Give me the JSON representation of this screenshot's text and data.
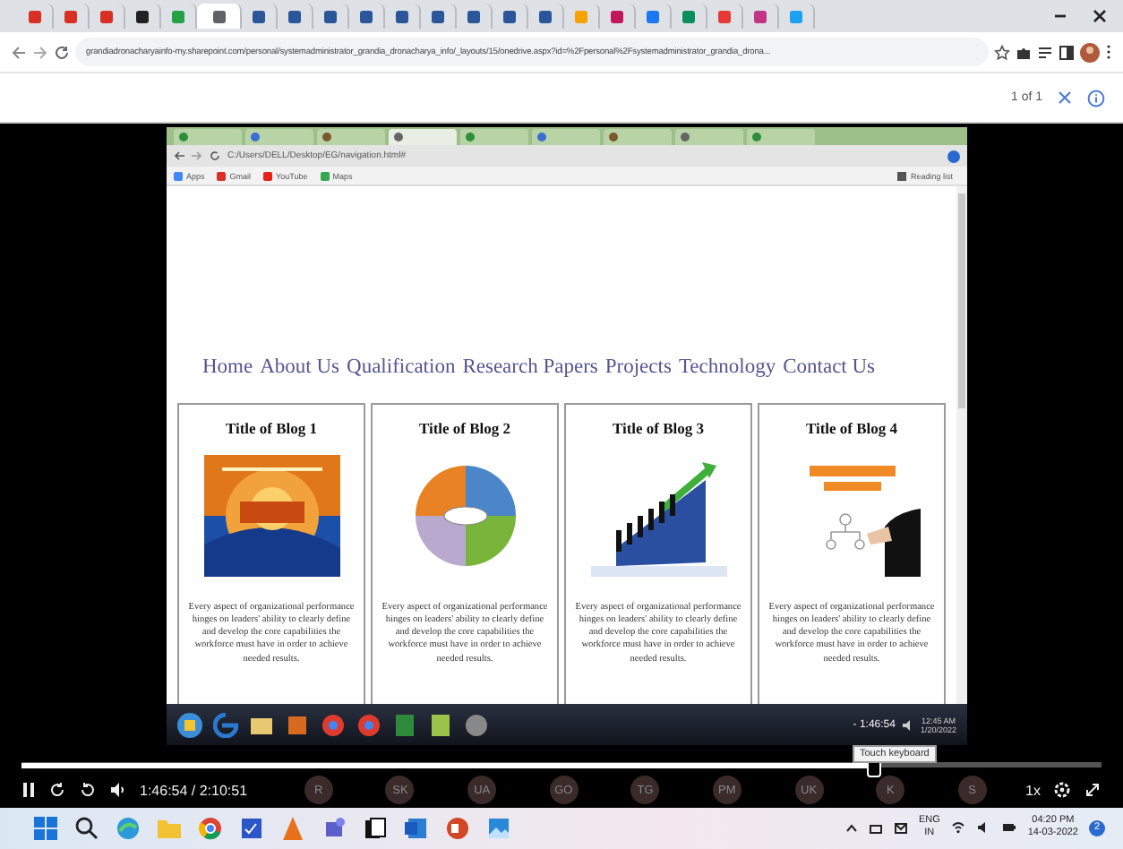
{
  "browser": {
    "tabs": [
      {
        "selected": false
      },
      {
        "selected": false
      },
      {
        "selected": false
      },
      {
        "selected": false
      },
      {
        "selected": false
      },
      {
        "selected": true
      },
      {
        "selected": false
      },
      {
        "selected": false
      },
      {
        "selected": false
      },
      {
        "selected": false
      },
      {
        "selected": false
      },
      {
        "selected": false
      },
      {
        "selected": false
      },
      {
        "selected": false
      },
      {
        "selected": false
      },
      {
        "selected": false
      },
      {
        "selected": false
      },
      {
        "selected": false
      },
      {
        "selected": false
      },
      {
        "selected": false
      },
      {
        "selected": false
      },
      {
        "selected": false
      }
    ],
    "address": "grandiadronacharyainfo-my.sharepoint.com/personal/systemadministrator_grandia_dronacharya_info/_layouts/15/onedrive.aspx?id=%2Fpersonal%2Fsystemadministrator_grandia_drona...",
    "page_count": "1 of 1"
  },
  "video": {
    "inner_browser": {
      "tabs": [
        {
          "selected": false
        },
        {
          "selected": false
        },
        {
          "selected": false
        },
        {
          "selected": true
        },
        {
          "selected": false
        },
        {
          "selected": false
        },
        {
          "selected": false
        },
        {
          "selected": false
        },
        {
          "selected": false
        }
      ],
      "address": "C:/Users/DELL/Desktop/EG/navigation.html#",
      "bookmarks": [
        "Apps",
        "Gmail",
        "YouTube",
        "Maps"
      ],
      "reading_list": "Reading list"
    },
    "nav": [
      "Home",
      "About Us",
      "Qualification",
      "Research Papers",
      "Projects",
      "Technology",
      "Contact Us"
    ],
    "blogs": [
      {
        "title": "Title of Blog 1",
        "text": "Every aspect of organizational performance hinges on leaders' ability to clearly define and develop the core capabilities the workforce must have in order to achieve needed results."
      },
      {
        "title": "Title of Blog 2",
        "text": "Every aspect of organizational performance hinges on leaders' ability to clearly define and develop the core capabilities the workforce must have in order to achieve needed results."
      },
      {
        "title": "Title of Blog 3",
        "text": "Every aspect of organizational performance hinges on leaders' ability to clearly define and develop the core capabilities the workforce must have in order to achieve needed results."
      },
      {
        "title": "Title of Blog 4",
        "text": "Every aspect of organizational performance hinges on leaders' ability to clearly define and develop the core capabilities the workforce must have in order to achieve needed results."
      }
    ],
    "taskbar": {
      "timer": "- 1:46:54",
      "time": "12:45 AM",
      "date": "1/20/2022"
    }
  },
  "player": {
    "level": 0.79,
    "time": "1:46:54 / 2:10:51",
    "participants": [
      "R",
      "SK",
      "UA",
      "GO",
      "TG",
      "PM",
      "UK",
      "K",
      "S"
    ],
    "tooltip": "Touch keyboard",
    "speed": "1x"
  },
  "taskbar": {
    "lang": "ENG",
    "region": "IN",
    "time": "04:20 PM",
    "date": "14-03-2022",
    "notifications": "2"
  }
}
